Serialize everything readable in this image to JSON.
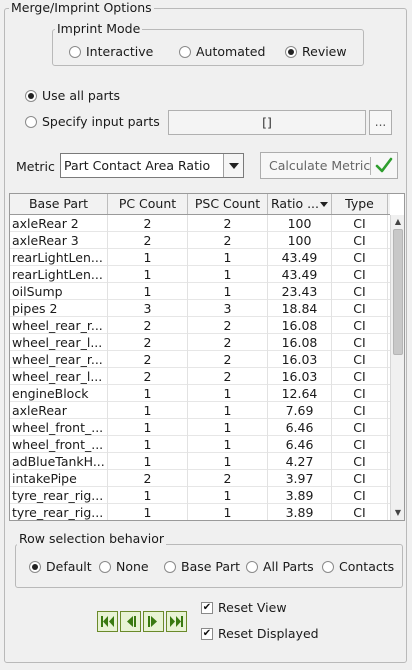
{
  "panel": {
    "title": "Merge/Imprint Options"
  },
  "imprint_mode": {
    "title": "Imprint Mode",
    "options": [
      "Interactive",
      "Automated",
      "Review"
    ],
    "selected": "Review"
  },
  "parts_selection": {
    "use_all_label": "Use all parts",
    "specify_label": "Specify input parts",
    "selected": "Use all parts",
    "input_value": "[]",
    "browse_label": "..."
  },
  "metric": {
    "label": "Metric",
    "value": "Part Contact Area Ratio",
    "calculate_label": "Calculate Metric",
    "accent": "#2e9e2e"
  },
  "table": {
    "columns": [
      "Base Part",
      "PC Count",
      "PSC Count",
      "Ratio ...",
      "Type"
    ],
    "sort_column": "Ratio ...",
    "rows": [
      [
        "axleRear 2",
        "2",
        "2",
        "100",
        "CI"
      ],
      [
        "axleRear 3",
        "2",
        "2",
        "100",
        "CI"
      ],
      [
        "rearLightLen...",
        "1",
        "1",
        "43.49",
        "CI"
      ],
      [
        "rearLightLen...",
        "1",
        "1",
        "43.49",
        "CI"
      ],
      [
        "oilSump",
        "1",
        "1",
        "23.43",
        "CI"
      ],
      [
        "pipes 2",
        "3",
        "3",
        "18.84",
        "CI"
      ],
      [
        "wheel_rear_r...",
        "2",
        "2",
        "16.08",
        "CI"
      ],
      [
        "wheel_rear_l...",
        "2",
        "2",
        "16.08",
        "CI"
      ],
      [
        "wheel_rear_r...",
        "2",
        "2",
        "16.03",
        "CI"
      ],
      [
        "wheel_rear_l...",
        "2",
        "2",
        "16.03",
        "CI"
      ],
      [
        "engineBlock",
        "1",
        "1",
        "12.64",
        "CI"
      ],
      [
        "axleRear",
        "1",
        "1",
        "7.69",
        "CI"
      ],
      [
        "wheel_front_...",
        "1",
        "1",
        "6.46",
        "CI"
      ],
      [
        "wheel_front_...",
        "1",
        "1",
        "6.46",
        "CI"
      ],
      [
        "adBlueTankH...",
        "1",
        "1",
        "4.27",
        "CI"
      ],
      [
        "intakePipe",
        "2",
        "2",
        "3.97",
        "CI"
      ],
      [
        "tyre_rear_rig...",
        "1",
        "1",
        "3.89",
        "CI"
      ],
      [
        "tyre_rear_rig...",
        "1",
        "1",
        "3.89",
        "CI"
      ]
    ]
  },
  "row_selection": {
    "title": "Row selection behavior",
    "options": [
      "Default",
      "None",
      "Base Part",
      "All Parts",
      "Contacts"
    ],
    "selected": "Default"
  },
  "navigation": {
    "buttons": [
      "first-icon",
      "previous-icon",
      "next-icon",
      "last-icon"
    ],
    "color": "#3a7a10"
  },
  "options": {
    "reset_view_label": "Reset View",
    "reset_view_checked": true,
    "reset_displayed_label": "Reset Displayed",
    "reset_displayed_checked": true
  }
}
